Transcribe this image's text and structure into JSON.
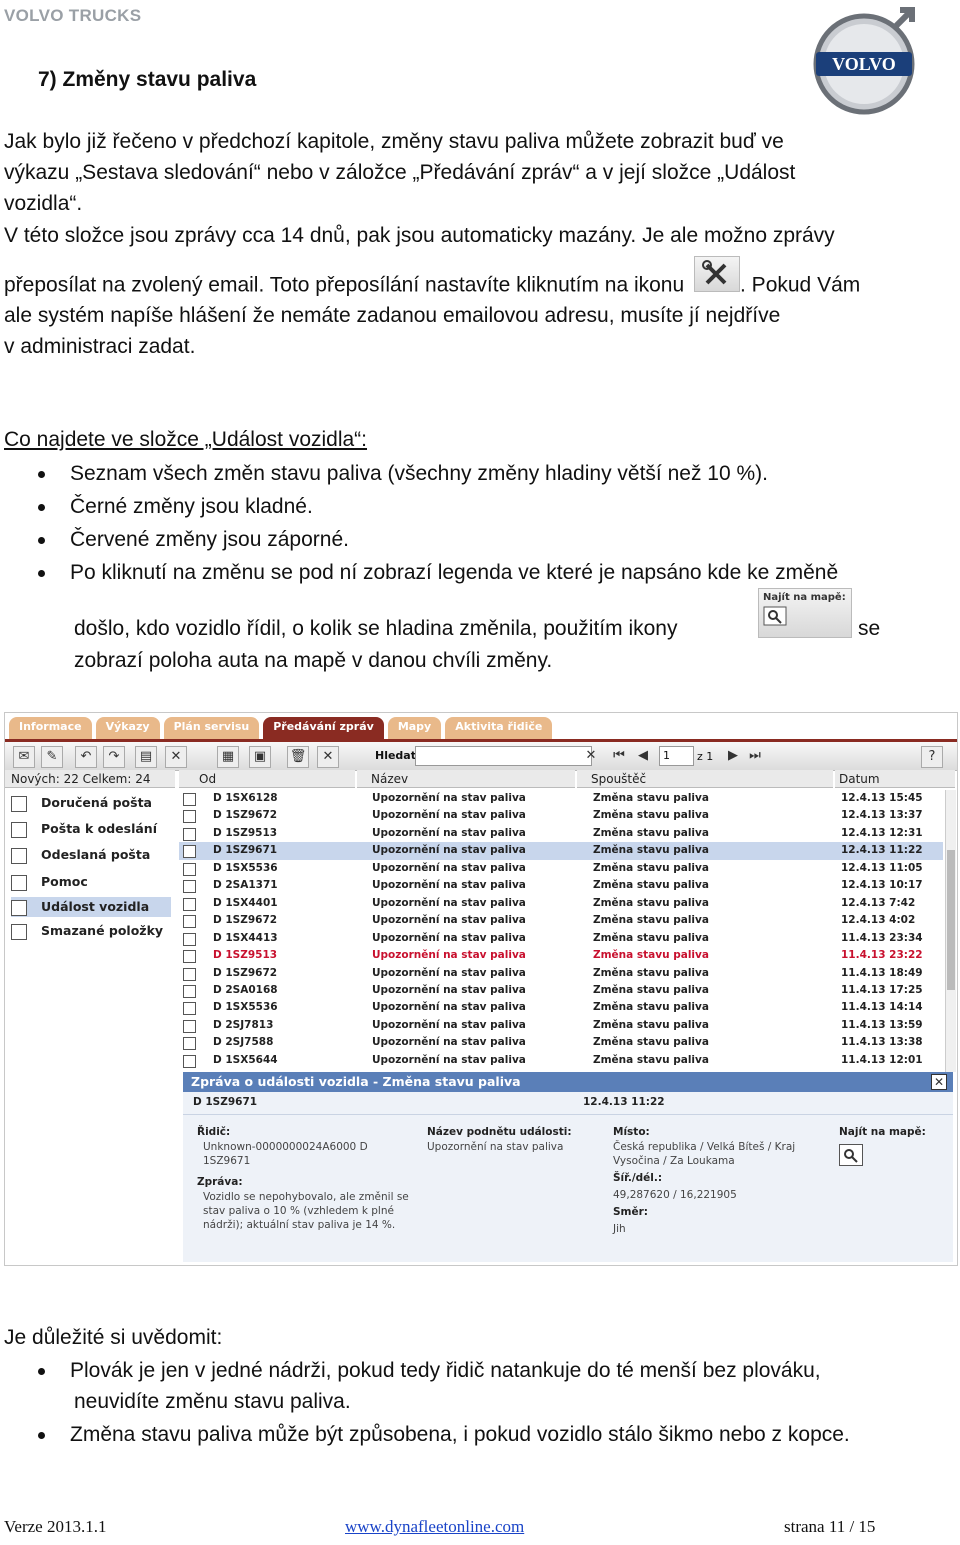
{
  "header": {
    "brand": "VOLVO TRUCKS",
    "logo_text": "VOLVO",
    "title": "7)  Změny stavu paliva"
  },
  "intro": {
    "l1": "Jak bylo již řečeno v předchozí kapitole, změny stavu paliva můžete zobrazit buď ve",
    "l2": "výkazu „Sestava sledování“ nebo v záložce „Předávání zpráv“ a v její složce „Událost",
    "l3": "vozidla“.",
    "l4": "V této složce jsou zprávy cca 14 dnů, pak jsou automaticky mazány. Je ale možno zprávy",
    "l5a": "přeposílat na zvolený email. Toto přeposílání nastavíte kliknutím na ikonu",
    "l5b": ". Pokud Vám",
    "l6": "ale systém napíše hlášení že nemáte zadanou emailovou adresu, musíte jí nejdříve",
    "l7": "v administraci zadat."
  },
  "section1": {
    "heading": "Co najdete ve složce „Událost vozidla“:",
    "bullets": [
      "Seznam všech změn stavu paliva (všechny změny hladiny větší než 10 %).",
      "Černé změny jsou kladné.",
      "Červené změny jsou záporné.",
      "Po kliknutí na změnu se pod ní zobrazí legenda ve které je napsáno kde ke změně"
    ],
    "cont_a": "došlo, kdo vozidlo řídil, o kolik se hladina změnila, použitím ikony",
    "cont_b": "se",
    "cont_c": "zobrazí poloha auta na mapě v danou chvíli změny.",
    "map_icon_label": "Najít na mapě:"
  },
  "app": {
    "tabs": [
      "Informace",
      "Výkazy",
      "Plán servisu",
      "Předávání zpráv",
      "Mapy",
      "Aktivita řidiče"
    ],
    "search_label": "Hledat",
    "page_value": "1",
    "page_total": "z 1",
    "counts": "Nových:   22   Celkem:  24",
    "columns": [
      "Od",
      "Název",
      "Spouštěč",
      "Datum"
    ],
    "folders": [
      "Doručená pošta",
      "Pošta k odeslání",
      "Odeslaná pošta",
      "Pomoc",
      "Událost vozidla",
      "Smazané položky"
    ],
    "rows": [
      {
        "from": "D 1SX6128",
        "name": "Upozornění na stav paliva",
        "trigger": "Změna stavu paliva",
        "date": "12.4.13 15:45",
        "red": false
      },
      {
        "from": "D 1SZ9672",
        "name": "Upozornění na stav paliva",
        "trigger": "Změna stavu paliva",
        "date": "12.4.13 13:37",
        "red": false
      },
      {
        "from": "D 1SZ9513",
        "name": "Upozornění na stav paliva",
        "trigger": "Změna stavu paliva",
        "date": "12.4.13 12:31",
        "red": false
      },
      {
        "from": "D 1SZ9671",
        "name": "Upozornění na stav paliva",
        "trigger": "Změna stavu paliva",
        "date": "12.4.13 11:22",
        "red": false
      },
      {
        "from": "D 1SX5536",
        "name": "Upozornění na stav paliva",
        "trigger": "Změna stavu paliva",
        "date": "12.4.13 11:05",
        "red": false
      },
      {
        "from": "D 2SA1371",
        "name": "Upozornění na stav paliva",
        "trigger": "Změna stavu paliva",
        "date": "12.4.13 10:17",
        "red": false
      },
      {
        "from": "D 1SX4401",
        "name": "Upozornění na stav paliva",
        "trigger": "Změna stavu paliva",
        "date": "12.4.13 7:42",
        "red": false
      },
      {
        "from": "D 1SZ9672",
        "name": "Upozornění na stav paliva",
        "trigger": "Změna stavu paliva",
        "date": "12.4.13 4:02",
        "red": false
      },
      {
        "from": "D 1SX4413",
        "name": "Upozornění na stav paliva",
        "trigger": "Změna stavu paliva",
        "date": "11.4.13 23:34",
        "red": false
      },
      {
        "from": "D 1SZ9513",
        "name": "Upozornění na stav paliva",
        "trigger": "Změna stavu paliva",
        "date": "11.4.13 23:22",
        "red": true
      },
      {
        "from": "D 1SZ9672",
        "name": "Upozornění na stav paliva",
        "trigger": "Změna stavu paliva",
        "date": "11.4.13 18:49",
        "red": false
      },
      {
        "from": "D 2SA0168",
        "name": "Upozornění na stav paliva",
        "trigger": "Změna stavu paliva",
        "date": "11.4.13 17:25",
        "red": false
      },
      {
        "from": "D 1SX5536",
        "name": "Upozornění na stav paliva",
        "trigger": "Změna stavu paliva",
        "date": "11.4.13 14:14",
        "red": false
      },
      {
        "from": "D 2SJ7813",
        "name": "Upozornění na stav paliva",
        "trigger": "Změna stavu paliva",
        "date": "11.4.13 13:59",
        "red": false
      },
      {
        "from": "D 2SJ7588",
        "name": "Upozornění na stav paliva",
        "trigger": "Změna stavu paliva",
        "date": "11.4.13 13:38",
        "red": false
      },
      {
        "from": "D 1SX5644",
        "name": "Upozornění na stav paliva",
        "trigger": "Změna stavu paliva",
        "date": "11.4.13 12:01",
        "red": false
      }
    ],
    "detail": {
      "title": "Zpráva o události vozidla - Změna stavu paliva",
      "id": "D 1SZ9671",
      "date": "12.4.13 11:22",
      "driver_label": "Řidič:",
      "driver_value": "Unknown-0000000024A6000 D 1SZ9671",
      "message_label": "Zpráva:",
      "message_value": "Vozidlo se nepohybovalo, ale změnil se stav paliva o 10 % (vzhledem k plné nádrži); aktuální stav paliva je 14 %.",
      "event_label": "Název podnětu události:",
      "event_value": "Upozornění na stav paliva",
      "place_label": "Místo:",
      "place_value": "Česká republika / Velká Bíteš / Kraj Vysočina / Za Loukama",
      "coords_label": "Šíř./dél.:",
      "coords_value": "49,287620 / 16,221905",
      "dir_label": "Směr:",
      "dir_value": "Jih",
      "map_label": "Najít na mapě:"
    }
  },
  "section2": {
    "heading": "Je důležité si uvědomit:",
    "b1a": "Plovák je jen v jedné nádrži, pokud tedy řidič natankuje do té menší bez plováku,",
    "b1b": "neuvidíte změnu stavu paliva.",
    "b2": "Změna stavu paliva může být způsobena, i pokud vozidlo stálo šikmo nebo z kopce."
  },
  "footer": {
    "version": "Verze 2013.1.1",
    "url": "www.dynafleetonline.com",
    "page": "strana  11 / 15"
  }
}
